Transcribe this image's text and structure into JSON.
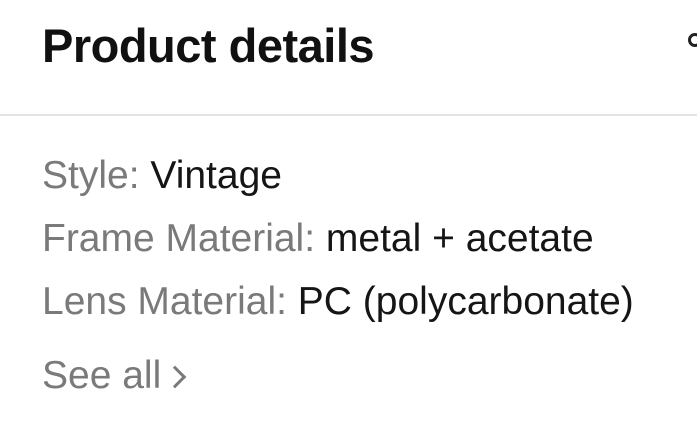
{
  "header": {
    "title": "Product details"
  },
  "details": [
    {
      "label": "Style:",
      "value": " Vintage"
    },
    {
      "label": "Frame Material:",
      "value": " metal + acetate"
    },
    {
      "label": "Lens Material:",
      "value": " PC (polycarbonate)"
    }
  ],
  "see_all": {
    "label": "See all"
  },
  "icons": {
    "header_edge": "search-icon",
    "see_all": "chevron-right-icon"
  }
}
